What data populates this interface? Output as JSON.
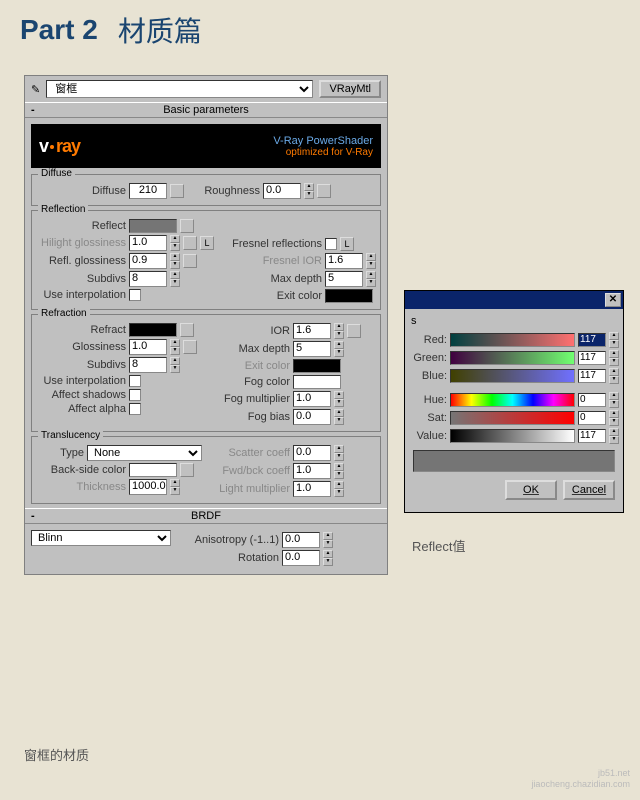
{
  "title": {
    "part": "Part 2",
    "sub": "材质篇"
  },
  "topbar": {
    "material_name": "窗框",
    "type_button": "VRayMtl"
  },
  "sections": {
    "basic": "Basic parameters",
    "brdf": "BRDF"
  },
  "vray": {
    "logo_pre": "v",
    "logo_post": "ray",
    "line1": "V-Ray PowerShader",
    "line2": "optimized for V-Ray"
  },
  "diffuse": {
    "group": "Diffuse",
    "label": "Diffuse",
    "value": "210",
    "roughness_label": "Roughness",
    "roughness": "0.0"
  },
  "reflection": {
    "group": "Reflection",
    "reflect_label": "Reflect",
    "hilight_label": "Hilight glossiness",
    "hilight": "1.0",
    "lock": "L",
    "refl_gloss_label": "Refl. glossiness",
    "refl_gloss": "0.9",
    "subdivs_label": "Subdivs",
    "subdivs": "8",
    "use_interp_label": "Use interpolation",
    "fresnel_label": "Fresnel reflections",
    "fresnel_ior_label": "Fresnel IOR",
    "fresnel_ior": "1.6",
    "max_depth_label": "Max depth",
    "max_depth": "5",
    "exit_label": "Exit color"
  },
  "refraction": {
    "group": "Refraction",
    "refract_label": "Refract",
    "ior_label": "IOR",
    "ior": "1.6",
    "gloss_label": "Glossiness",
    "gloss": "1.0",
    "max_depth_label": "Max depth",
    "max_depth": "5",
    "subdivs_label": "Subdivs",
    "subdivs": "8",
    "exit_label": "Exit color",
    "use_interp_label": "Use interpolation",
    "fog_color_label": "Fog color",
    "affect_shadows_label": "Affect shadows",
    "fog_mult_label": "Fog multiplier",
    "fog_mult": "1.0",
    "affect_alpha_label": "Affect alpha",
    "fog_bias_label": "Fog bias",
    "fog_bias": "0.0"
  },
  "translucency": {
    "group": "Translucency",
    "type_label": "Type",
    "type_value": "None",
    "scatter_label": "Scatter coeff",
    "scatter": "0.0",
    "back_label": "Back-side color",
    "fwd_label": "Fwd/bck coeff",
    "fwd": "1.0",
    "thick_label": "Thickness",
    "thick": "1000.0",
    "light_label": "Light multiplier",
    "light": "1.0"
  },
  "brdf": {
    "type": "Blinn",
    "aniso_label": "Anisotropy (-1..1)",
    "aniso": "0.0",
    "rot_label": "Rotation",
    "rot": "0.0"
  },
  "color_dlg": {
    "s": "s",
    "red_label": "Red:",
    "red": "117",
    "green_label": "Green:",
    "green": "117",
    "blue_label": "Blue:",
    "blue": "117",
    "hue_label": "Hue:",
    "hue": "0",
    "sat_label": "Sat:",
    "sat": "0",
    "val_label": "Value:",
    "val": "117",
    "ok": "OK",
    "cancel": "Cancel"
  },
  "captions": {
    "bottom": "窗框的材质",
    "right": "Reflect值"
  },
  "watermark": {
    "l1": "jb51.net",
    "l2": "jiaocheng.chazidian.com"
  }
}
